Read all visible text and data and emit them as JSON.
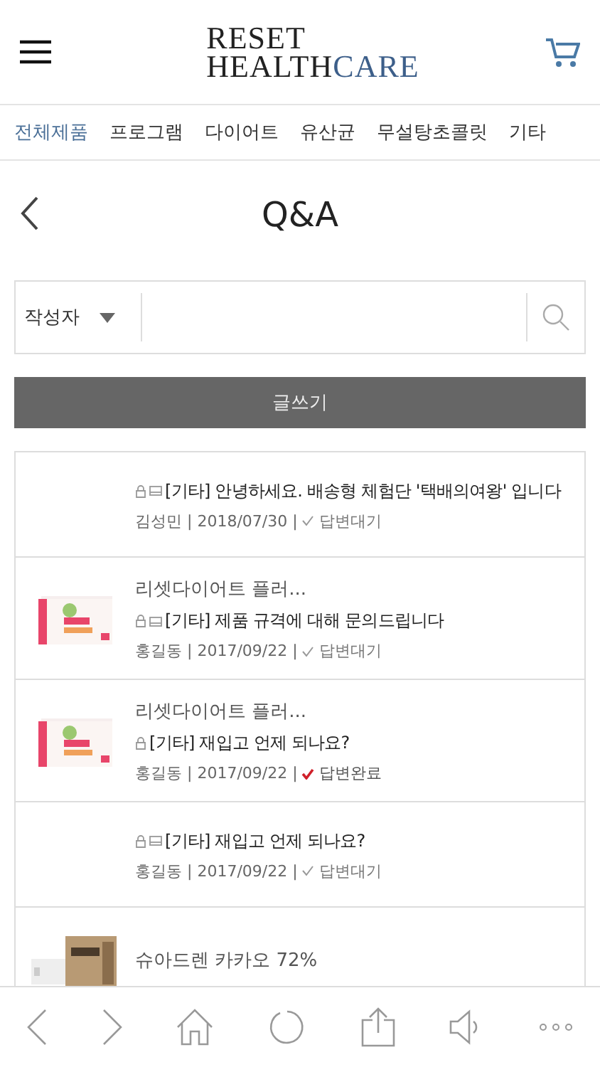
{
  "logo": {
    "line1": "RESET",
    "line2_dark": "HEALTH",
    "line2_accent": "CARE"
  },
  "categories": [
    {
      "label": "전체제품",
      "selected": true
    },
    {
      "label": "프로그램",
      "selected": false
    },
    {
      "label": "다이어트",
      "selected": false
    },
    {
      "label": "유산균",
      "selected": false
    },
    {
      "label": "무설탕초콜릿",
      "selected": false
    },
    {
      "label": "기타",
      "selected": false
    }
  ],
  "page_title": "Q&A",
  "search": {
    "filter": "작성자"
  },
  "write_button": "글쓰기",
  "posts": [
    {
      "locked": true,
      "mail": true,
      "title": "[기타] 안녕하세요. 배송형 체험단 '택배의여왕' 입니다",
      "meta": "김성민 | 2018/07/30 |",
      "status": "답변대기",
      "answered": false
    },
    {
      "product": "리셋다이어트 플러...",
      "locked": true,
      "mail": true,
      "title": "[기타] 제품 규격에 대해 문의드립니다",
      "meta": "홍길동 | 2017/09/22 |",
      "status": "답변대기",
      "answered": false
    },
    {
      "product": "리셋다이어트 플러...",
      "locked": true,
      "mail": false,
      "title": "[기타] 재입고 언제 되나요?",
      "meta": "홍길동 | 2017/09/22 |",
      "status": "답변완료",
      "answered": true
    },
    {
      "locked": true,
      "mail": true,
      "title": "[기타] 재입고 언제 되나요?",
      "meta": "홍길동 | 2017/09/22 |",
      "status": "답변대기",
      "answered": false
    },
    {
      "product": "슈아드렌 카카오 72%"
    }
  ]
}
